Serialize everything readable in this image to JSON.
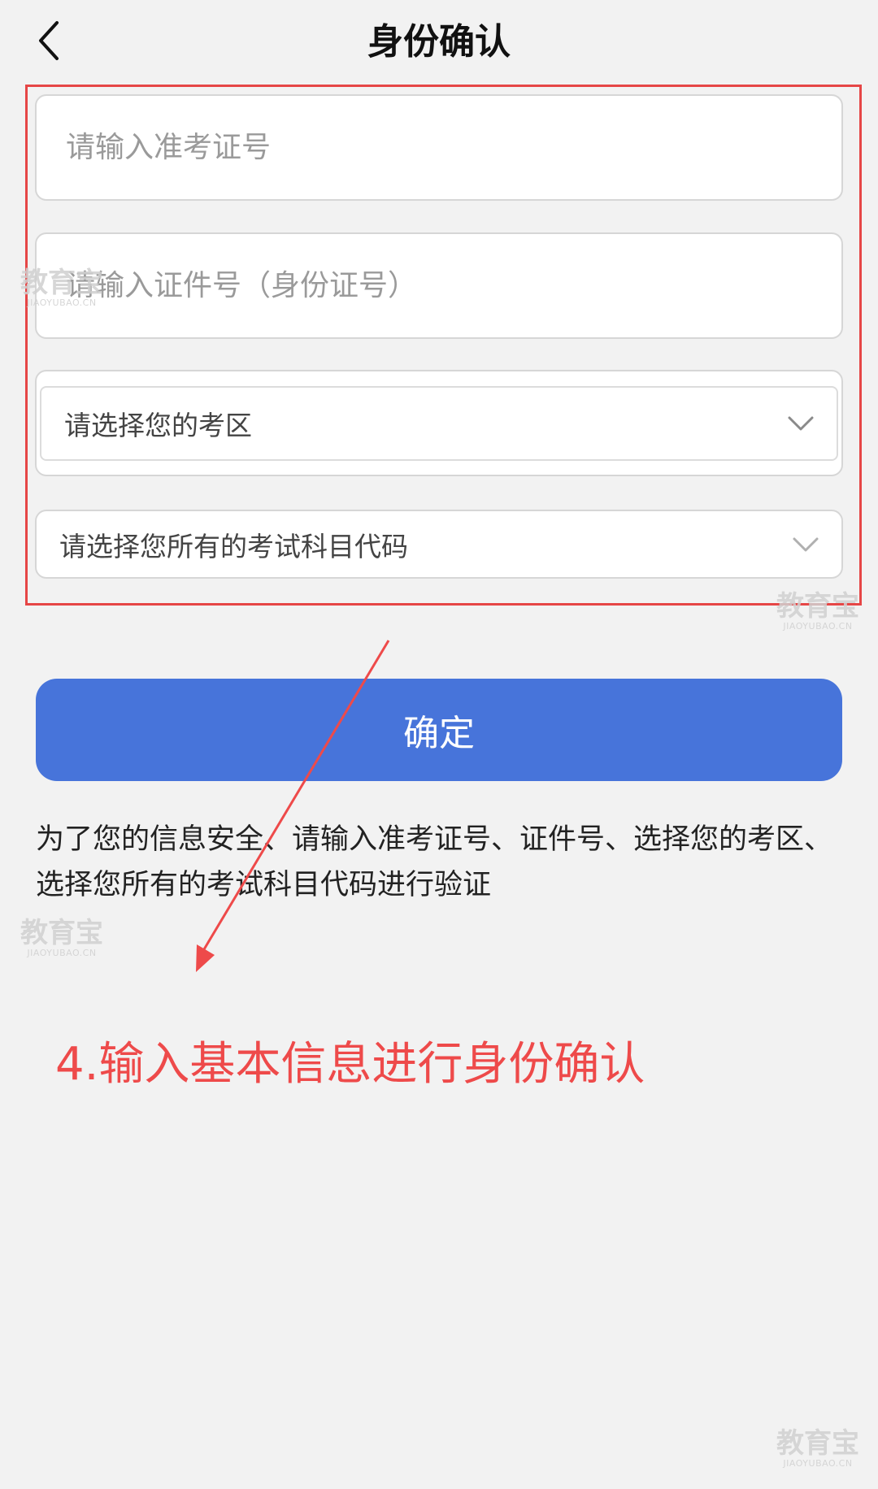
{
  "header": {
    "title": "身份确认"
  },
  "form": {
    "admission_ticket_placeholder": "请输入准考证号",
    "id_number_placeholder": "请输入证件号（身份证号）",
    "exam_area_select": "请选择您的考区",
    "subject_code_select": "请选择您所有的考试科目代码",
    "confirm_label": "确定"
  },
  "notice": {
    "text": "为了您的信息安全、请输入准考证号、证件号、选择您的考区、选择您所有的考试科目代码进行验证"
  },
  "annotation": {
    "text": "4.输入基本信息进行身份确认",
    "color": "#ee4a4a"
  },
  "watermark": {
    "name": "教育宝",
    "domain": "JIAOYUBAO.CN"
  },
  "colors": {
    "primary": "#4774da",
    "background": "#f2f2f2",
    "highlight": "#e64646"
  },
  "icons": {
    "back": "chevron-left-icon",
    "dropdown": "chevron-down-icon"
  }
}
